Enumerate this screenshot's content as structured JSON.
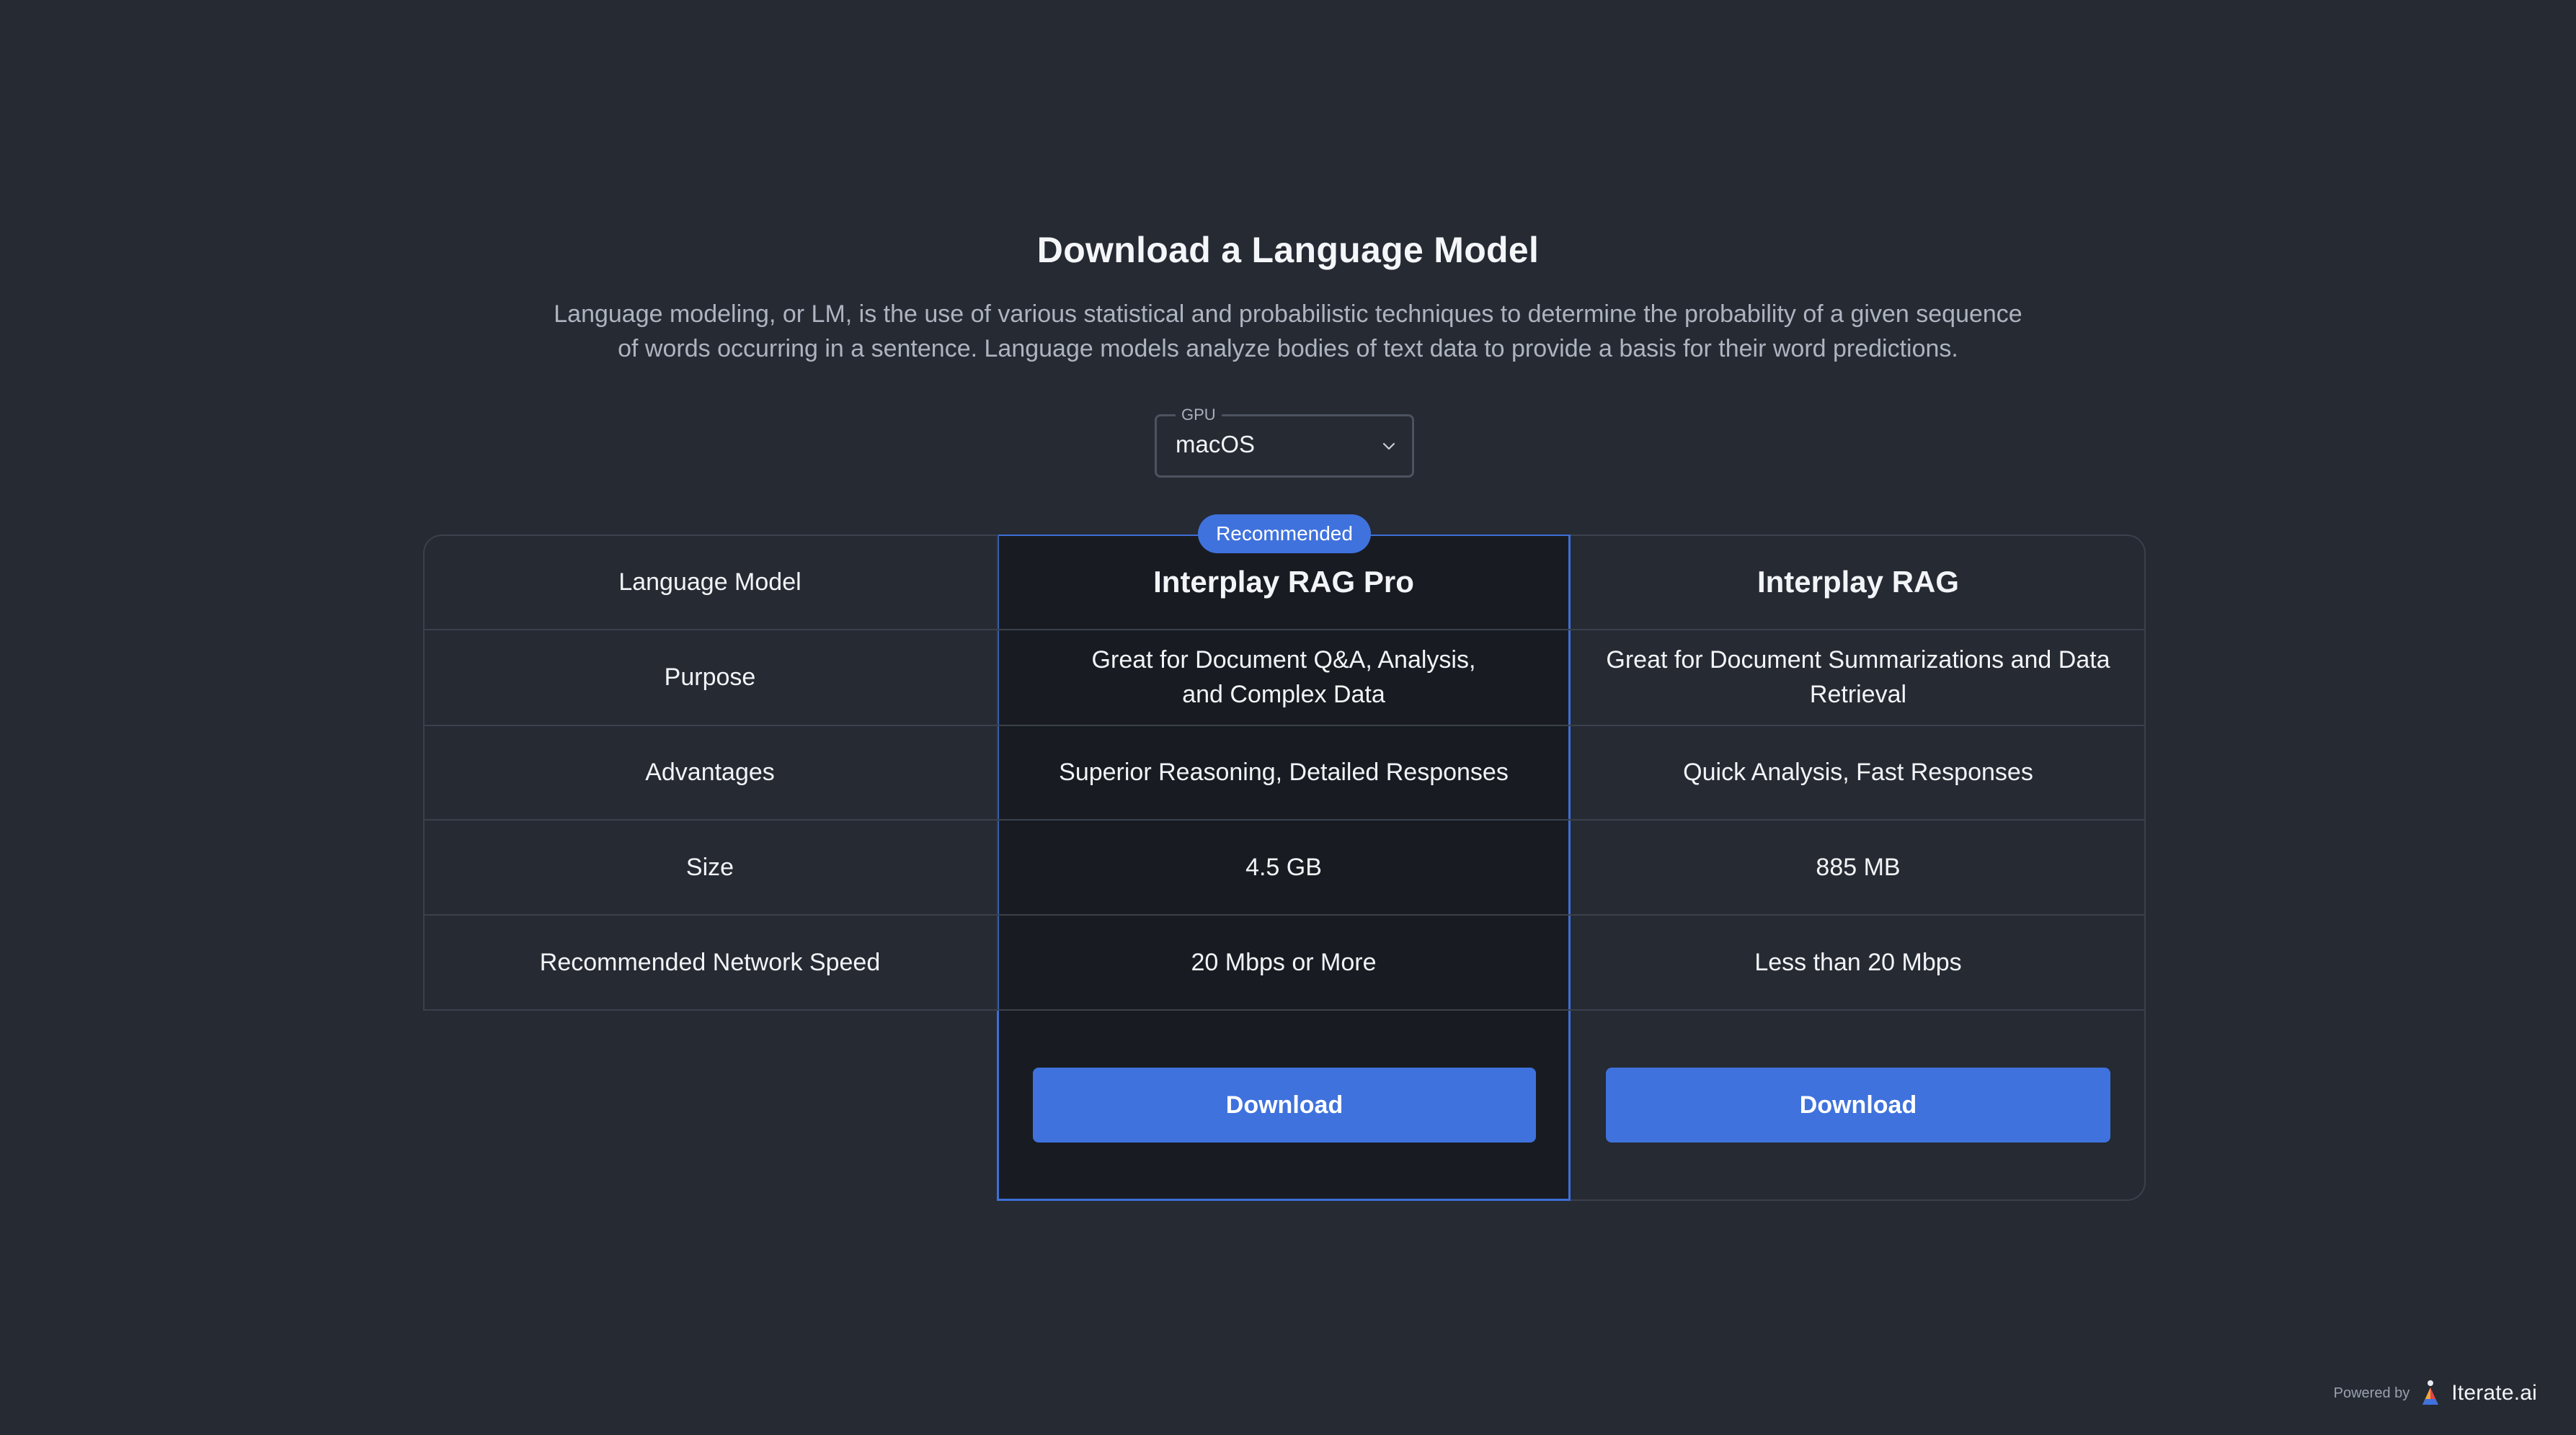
{
  "header": {
    "title": "Download a Language Model",
    "description_line1": "Language modeling, or LM, is the use of various statistical and probabilistic techniques to determine the probability of a given sequence",
    "description_line2": "of words occurring in a sentence. Language models analyze bodies of text data to provide a basis for their word predictions."
  },
  "gpu_select": {
    "label": "GPU",
    "value": "macOS",
    "icon": "chevron-down-icon"
  },
  "comparison": {
    "recommended_badge": "Recommended",
    "rows": {
      "model": "Language Model",
      "purpose": "Purpose",
      "advantages": "Advantages",
      "size": "Size",
      "network": "Recommended Network Speed"
    },
    "pro": {
      "name": "Interplay RAG Pro",
      "purpose": "Great for Document Q&A, Analysis, and Complex Data",
      "advantages": "Superior Reasoning, Detailed Responses",
      "size": "4.5 GB",
      "network": "20 Mbps or More",
      "download_label": "Download"
    },
    "standard": {
      "name": "Interplay RAG",
      "purpose": "Great for Document Summarizations and Data Retrieval",
      "advantages": "Quick Analysis, Fast Responses",
      "size": "885 MB",
      "network": "Less than 20 Mbps",
      "download_label": "Download"
    }
  },
  "footer": {
    "powered_by": "Powered by",
    "brand": "Iterate.ai",
    "logo_icon": "iterate-logo-icon"
  },
  "colors": {
    "background": "#252a33",
    "accent": "#3f72dd",
    "pro_column": "#181c22"
  }
}
